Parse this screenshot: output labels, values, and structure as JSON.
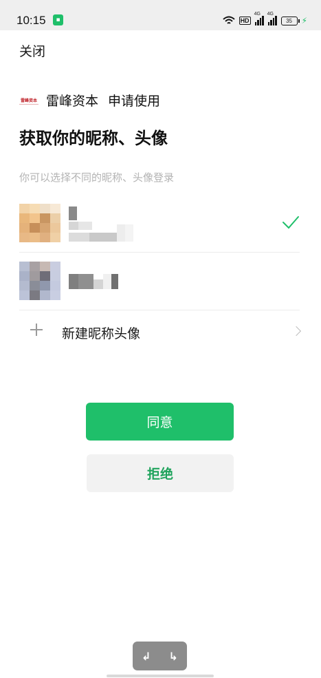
{
  "status_bar": {
    "time": "10:15",
    "hd_label": "HD",
    "signal_1_tag": "4G",
    "signal_2_tag": "4G",
    "battery": "35"
  },
  "header": {
    "close_label": "关闭"
  },
  "app": {
    "name": "雷峰资本",
    "action": "申请使用",
    "logo_text": "雷峰资本"
  },
  "page": {
    "title": "获取你的昵称、头像",
    "hint": "你可以选择不同的昵称、头像登录"
  },
  "accounts": [
    {
      "selected": true
    },
    {
      "selected": false
    }
  ],
  "new_profile": {
    "label": "新建昵称头像"
  },
  "buttons": {
    "agree": "同意",
    "reject": "拒绝"
  },
  "nav": {
    "back_glyph": "↲",
    "forward_glyph": "↳"
  },
  "colors": {
    "accent": "#1fbf6a",
    "reject_text": "#1fa35c",
    "reject_bg": "#f2f2f2"
  }
}
